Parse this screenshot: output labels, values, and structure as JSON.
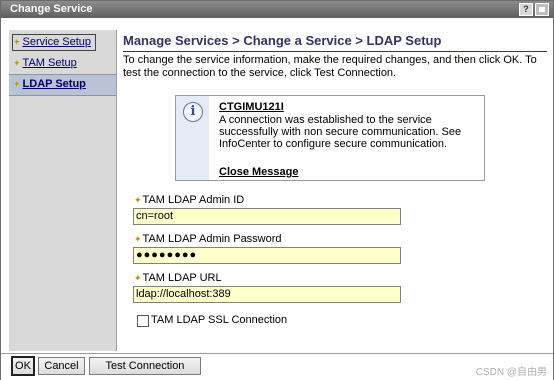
{
  "window": {
    "title": "Change Service",
    "help_label": "?"
  },
  "sidebar": {
    "items": [
      {
        "label": "Service Setup",
        "star": "✦"
      },
      {
        "label": "TAM Setup",
        "star": "✦"
      },
      {
        "label": "LDAP Setup",
        "star": "✦"
      }
    ]
  },
  "main": {
    "title": "Manage Services > Change a Service > LDAP Setup",
    "instructions": "To change the service information, make the required changes, and then click OK. To test the connection to the service, click Test Connection.",
    "message": {
      "icon": "info-icon",
      "icon_glyph": "i",
      "id": "CTGIMU121I",
      "text": "A connection was established to the service successfully with non secure communication. See InfoCenter to configure secure communication.",
      "close_label": "Close Message"
    },
    "fields": {
      "required_marker": "✦",
      "admin_id_label": "TAM LDAP Admin ID",
      "admin_id_value": "cn=root",
      "admin_password_label": "TAM LDAP Admin Password",
      "admin_password_value": "●●●●●●●●",
      "url_label": "TAM LDAP URL",
      "url_value": "ldap://localhost:389",
      "ssl_label": "TAM LDAP SSL Connection"
    }
  },
  "buttons": {
    "ok": "OK",
    "cancel": "Cancel",
    "test": "Test Connection"
  },
  "watermark": "CSDN @自由男",
  "colors": {
    "accent": "#333366",
    "input_bg": "#ffffcc",
    "selected_nav": "#b8c3d6"
  }
}
